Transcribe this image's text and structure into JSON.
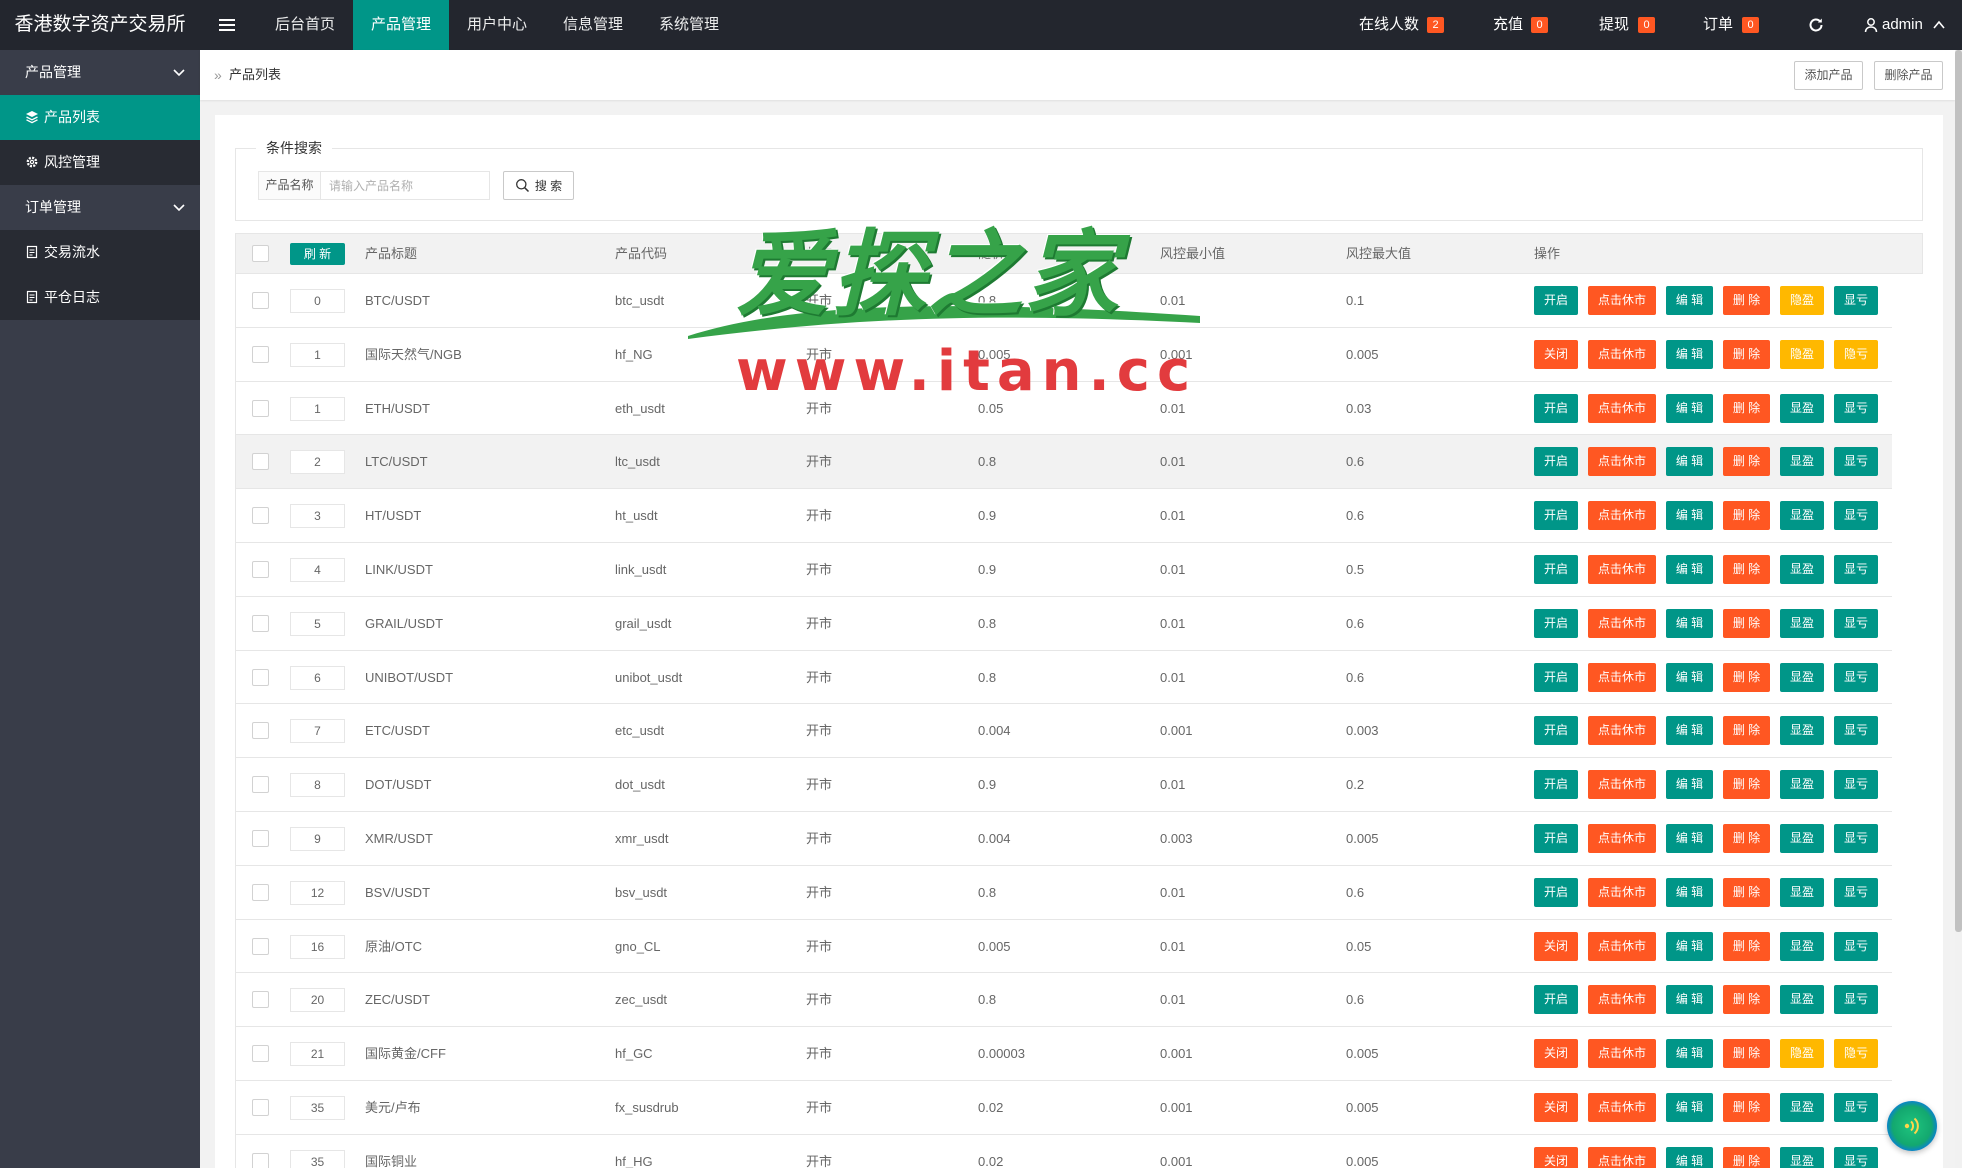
{
  "app": {
    "title": "香港数字资产交易所"
  },
  "topnav": {
    "items": [
      {
        "label": "后台首页"
      },
      {
        "label": "产品管理"
      },
      {
        "label": "用户中心"
      },
      {
        "label": "信息管理"
      },
      {
        "label": "系统管理"
      }
    ],
    "right": [
      {
        "label": "在线人数",
        "badge": "2"
      },
      {
        "label": "充值",
        "badge": "0"
      },
      {
        "label": "提现",
        "badge": "0"
      },
      {
        "label": "订单",
        "badge": "0"
      }
    ],
    "user": "admin"
  },
  "sidebar": {
    "groups": [
      {
        "label": "产品管理",
        "items": [
          {
            "label": "产品列表"
          },
          {
            "label": "风控管理"
          }
        ]
      },
      {
        "label": "订单管理",
        "items": [
          {
            "label": "交易流水"
          },
          {
            "label": "平仓日志"
          }
        ]
      }
    ]
  },
  "breadcrumb": {
    "current": "产品列表"
  },
  "toolbar": {
    "add_label": "添加产品",
    "delete_label": "删除产品"
  },
  "search": {
    "legend": "条件搜索",
    "label": "产品名称",
    "placeholder": "请输入产品名称",
    "button": "搜 索"
  },
  "table": {
    "refresh": "刷 新",
    "headers": [
      "产品标题",
      "产品代码",
      "状态",
      "随机值",
      "风控最小值",
      "风控最大值",
      "操作"
    ],
    "actions": {
      "close_market": "点击休市",
      "edit": "编 辑",
      "delete": "删 除"
    },
    "rows": [
      {
        "sort": "0",
        "title": "BTC/USDT",
        "code": "btc_usdt",
        "status": "开市",
        "random": "0.8",
        "min": "0.01",
        "max": "0.1",
        "switch": "开启",
        "profit": "隐盈",
        "loss": "显亏"
      },
      {
        "sort": "1",
        "title": "国际天然气/NGB",
        "code": "hf_NG",
        "status": "开市",
        "random": "0.005",
        "min": "0.001",
        "max": "0.005",
        "switch": "关闭",
        "profit": "隐盈",
        "loss": "隐亏"
      },
      {
        "sort": "1",
        "title": "ETH/USDT",
        "code": "eth_usdt",
        "status": "开市",
        "random": "0.05",
        "min": "0.01",
        "max": "0.03",
        "switch": "开启",
        "profit": "显盈",
        "loss": "显亏"
      },
      {
        "sort": "2",
        "title": "LTC/USDT",
        "code": "ltc_usdt",
        "status": "开市",
        "random": "0.8",
        "min": "0.01",
        "max": "0.6",
        "switch": "开启",
        "profit": "显盈",
        "loss": "显亏"
      },
      {
        "sort": "3",
        "title": "HT/USDT",
        "code": "ht_usdt",
        "status": "开市",
        "random": "0.9",
        "min": "0.01",
        "max": "0.6",
        "switch": "开启",
        "profit": "显盈",
        "loss": "显亏"
      },
      {
        "sort": "4",
        "title": "LINK/USDT",
        "code": "link_usdt",
        "status": "开市",
        "random": "0.9",
        "min": "0.01",
        "max": "0.5",
        "switch": "开启",
        "profit": "显盈",
        "loss": "显亏"
      },
      {
        "sort": "5",
        "title": "GRAIL/USDT",
        "code": "grail_usdt",
        "status": "开市",
        "random": "0.8",
        "min": "0.01",
        "max": "0.6",
        "switch": "开启",
        "profit": "显盈",
        "loss": "显亏"
      },
      {
        "sort": "6",
        "title": "UNIBOT/USDT",
        "code": "unibot_usdt",
        "status": "开市",
        "random": "0.8",
        "min": "0.01",
        "max": "0.6",
        "switch": "开启",
        "profit": "显盈",
        "loss": "显亏"
      },
      {
        "sort": "7",
        "title": "ETC/USDT",
        "code": "etc_usdt",
        "status": "开市",
        "random": "0.004",
        "min": "0.001",
        "max": "0.003",
        "switch": "开启",
        "profit": "显盈",
        "loss": "显亏"
      },
      {
        "sort": "8",
        "title": "DOT/USDT",
        "code": "dot_usdt",
        "status": "开市",
        "random": "0.9",
        "min": "0.01",
        "max": "0.2",
        "switch": "开启",
        "profit": "显盈",
        "loss": "显亏"
      },
      {
        "sort": "9",
        "title": "XMR/USDT",
        "code": "xmr_usdt",
        "status": "开市",
        "random": "0.004",
        "min": "0.003",
        "max": "0.005",
        "switch": "开启",
        "profit": "显盈",
        "loss": "显亏"
      },
      {
        "sort": "12",
        "title": "BSV/USDT",
        "code": "bsv_usdt",
        "status": "开市",
        "random": "0.8",
        "min": "0.01",
        "max": "0.6",
        "switch": "开启",
        "profit": "显盈",
        "loss": "显亏"
      },
      {
        "sort": "16",
        "title": "原油/OTC",
        "code": "gno_CL",
        "status": "开市",
        "random": "0.005",
        "min": "0.01",
        "max": "0.05",
        "switch": "关闭",
        "profit": "显盈",
        "loss": "显亏"
      },
      {
        "sort": "20",
        "title": "ZEC/USDT",
        "code": "zec_usdt",
        "status": "开市",
        "random": "0.8",
        "min": "0.01",
        "max": "0.6",
        "switch": "开启",
        "profit": "显盈",
        "loss": "显亏"
      },
      {
        "sort": "21",
        "title": "国际黄金/CFF",
        "code": "hf_GC",
        "status": "开市",
        "random": "0.00003",
        "min": "0.001",
        "max": "0.005",
        "switch": "关闭",
        "profit": "隐盈",
        "loss": "隐亏"
      },
      {
        "sort": "35",
        "title": "美元/卢布",
        "code": "fx_susdrub",
        "status": "开市",
        "random": "0.02",
        "min": "0.001",
        "max": "0.005",
        "switch": "关闭",
        "profit": "显盈",
        "loss": "显亏"
      },
      {
        "sort": "35",
        "title": "国际铜业",
        "code": "hf_HG",
        "status": "开市",
        "random": "0.02",
        "min": "0.001",
        "max": "0.005",
        "switch": "关闭",
        "profit": "显盈",
        "loss": "显亏"
      }
    ]
  },
  "watermark": {
    "title": "爱探之家",
    "url": "www.itan.cc"
  },
  "colors": {
    "primary": "#009688",
    "danger": "#FF5722",
    "warm": "#FFB800",
    "header": "#23262E",
    "sidebar": "#393D49",
    "sidebar_child": "#282B33"
  },
  "icons": {
    "menu": "menu-toggle-icon",
    "refresh": "refresh-icon",
    "user": "user-icon",
    "search": "search-icon",
    "gear": "gear-icon",
    "layers": "layers-icon",
    "document": "document-icon"
  }
}
